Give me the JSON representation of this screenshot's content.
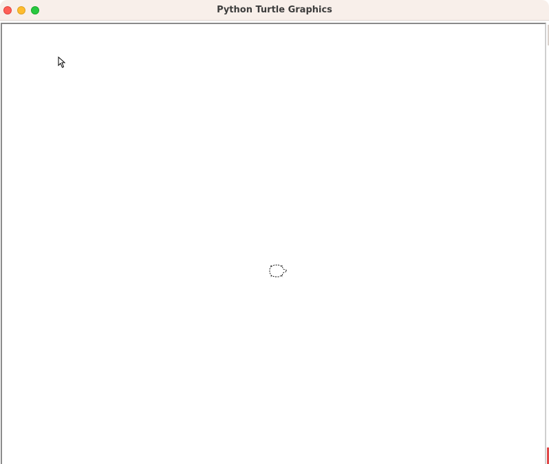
{
  "window": {
    "title": "Python Turtle Graphics"
  },
  "titlebar": {
    "buttons": [
      "close-icon",
      "minimize-icon",
      "zoom-icon"
    ]
  },
  "canvas": {
    "background": "#ffffff",
    "turtle_shape": "turtle-icon",
    "cursor_shape": "pointer-cursor-icon"
  }
}
